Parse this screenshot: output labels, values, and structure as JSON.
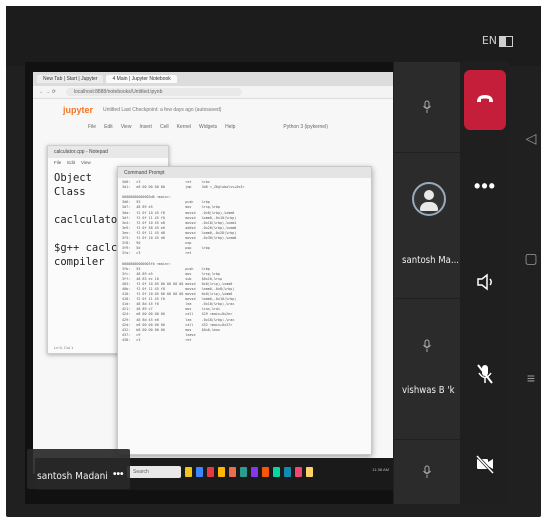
{
  "status_bar": {
    "lang": "EN"
  },
  "browser": {
    "tabs": [
      "New Tab | Start | Jupyter",
      "4 Main | Jupyter Notebook"
    ],
    "url": "localhost:8888/notebooks/Untitled.ipynb",
    "jupyter_title": "jupyter",
    "notebook_name": "Untitled Last Checkpoint: a few days ago (autosaved)",
    "menu": [
      "File",
      "Edit",
      "View",
      "Insert",
      "Cell",
      "Kernel",
      "Widgets",
      "Help"
    ],
    "kernel": "Python 3 (ipykernel)"
  },
  "notepad": {
    "title": "calculator.cpp - Notepad",
    "menu": [
      "File",
      "Edit",
      "View"
    ],
    "lines": [
      "Object",
      "Class",
      "",
      "caclculator.cpp",
      "",
      "$g++ caclculator.cpp",
      "compiler"
    ],
    "status": "Ln 5, Col 1"
  },
  "cmd": {
    "title": "Command Prompt",
    "rows": [
      "3d0:   c3                      ret     %rbx",
      "3d1:   e8 00 00 00 00          jmp     3d6 <_Z6globalvv+0x3>",
      "",
      "00000000000003d6 <main>:",
      "3d6:   55                      push    %rbp",
      "3d7:   48 89 e5                mov     %rsp,%rbp",
      "3da:   f2 0f 10 45 f8          movsd   -0x8(%rbp),%xmm0",
      "3df:   f2 0f 11 45 f0          movsd   %xmm0,-0x10(%rbp)",
      "3e4:   f2 0f 10 45 e8          movsd   -0x18(%rbp),%xmm1",
      "3e9:   f2 0f 58 45 e0          addsd   -0x20(%rbp),%xmm0",
      "3ee:   f2 0f 11 45 d8          movsd   %xmm0,-0x28(%rbp)",
      "3f3:   f2 0f 10 45 d0          movsd   -0x30(%rbp),%xmm0",
      "3f8:   90                      nop",
      "3f9:   5d                      pop     %rbp",
      "3fa:   c3                      ret",
      "",
      "00000000000003fb <main>:",
      "3fb:   55                      push    %rbp",
      "3fc:   48 89 e5                mov     %rsp,%rbp",
      "3ff:   48 83 ec 10             sub     $0x10,%rsp",
      "403:   f2 0f 10 05 00 00 00 00 movsd   0x0(%rip),%xmm0",
      "40b:   f2 0f 11 45 f8          movsd   %xmm0,-0x8(%rbp)",
      "410:   f2 0f 10 05 00 00 00 00 movsd   0x0(%rip),%xmm0",
      "418:   f2 0f 11 45 f0          movsd   %xmm0,-0x10(%rbp)",
      "41d:   48 8d 45 f0             lea     -0x10(%rbp),%rax",
      "421:   48 89 c7                mov     %rax,%rdi",
      "424:   e8 00 00 00 00          call    429 <main+0x2e>",
      "429:   48 8d 45 e8             lea     -0x18(%rbp),%rax",
      "42d:   e8 00 00 00 00          call    432 <main+0x37>",
      "432:   b8 00 00 00 00          mov     $0x0,%eax",
      "437:   c9                      leave",
      "438:   c3                      ret"
    ]
  },
  "taskbar": {
    "search": "Search",
    "clock": "11:38 AM"
  },
  "presenter": {
    "name": "santosh Madani",
    "more": "•••"
  },
  "participants": [
    {
      "name": "santosh Ma..."
    },
    {
      "name": "vishwas B 'k"
    }
  ],
  "colors": {
    "leave": "#c41e3a",
    "avatar_ring": "#9ab"
  },
  "controls": [
    "leave-call",
    "more-options",
    "speaker",
    "mic-off",
    "camera-off"
  ]
}
